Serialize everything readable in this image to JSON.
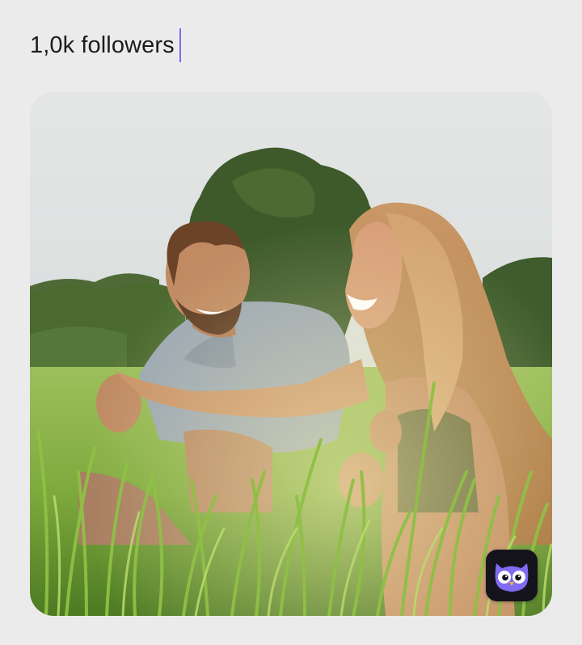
{
  "post": {
    "caption": "1,0k followers"
  },
  "photo": {
    "subject": "couple-laughing-in-tall-grass"
  },
  "badge": {
    "icon": "owl-icon",
    "bg_color": "#15131b",
    "owl_color": "#7f6cf2"
  },
  "accent_color": "#7b6cf0"
}
